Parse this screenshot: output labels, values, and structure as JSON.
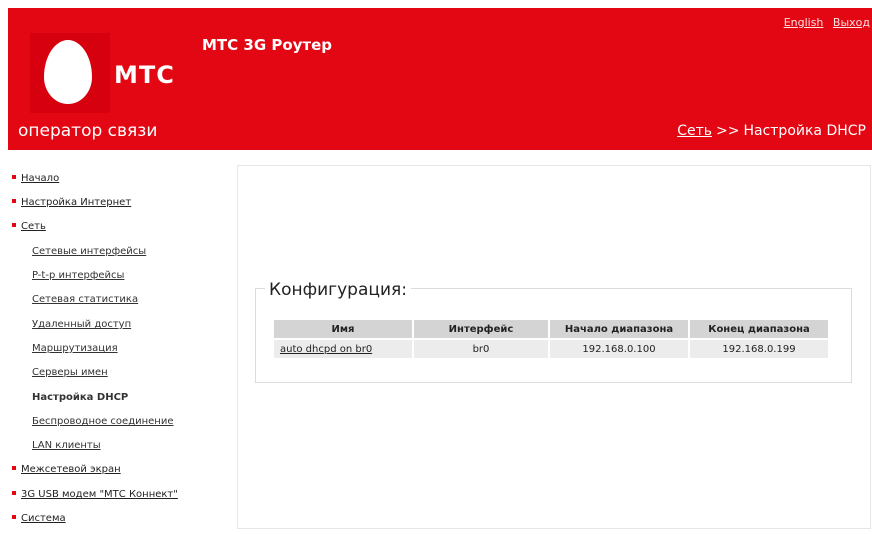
{
  "header": {
    "app_title": "МТС 3G Роутер",
    "logo_text": "МТС",
    "tagline": "оператор связи",
    "links": {
      "english": "English",
      "logout": "Выход"
    },
    "breadcrumb": {
      "parent": "Сеть",
      "separator": ">>",
      "current": "Настройка DHCP"
    },
    "brand_color": "#e30613"
  },
  "sidebar": {
    "items": [
      {
        "label": "Начало"
      },
      {
        "label": "Настройка Интернет"
      },
      {
        "label": "Сеть"
      },
      {
        "label": "Сетевые интерфейсы"
      },
      {
        "label": "P-t-p интерфейсы"
      },
      {
        "label": "Сетевая статистика"
      },
      {
        "label": "Удаленный доступ"
      },
      {
        "label": "Маршрутизация"
      },
      {
        "label": "Серверы имен"
      },
      {
        "label": "Настройка DHCP"
      },
      {
        "label": "Беспроводное соединение"
      },
      {
        "label": "LAN клиенты"
      },
      {
        "label": "Межсетевой экран"
      },
      {
        "label": "3G USB модем \"МТС Коннект\""
      },
      {
        "label": "Система"
      }
    ]
  },
  "main": {
    "section_title": "Конфигурация:",
    "table": {
      "headers": [
        "Имя",
        "Интерфейс",
        "Начало диапазона",
        "Конец диапазона"
      ],
      "rows": [
        [
          "auto dhcpd on br0",
          "br0",
          "192.168.0.100",
          "192.168.0.199"
        ]
      ]
    }
  }
}
